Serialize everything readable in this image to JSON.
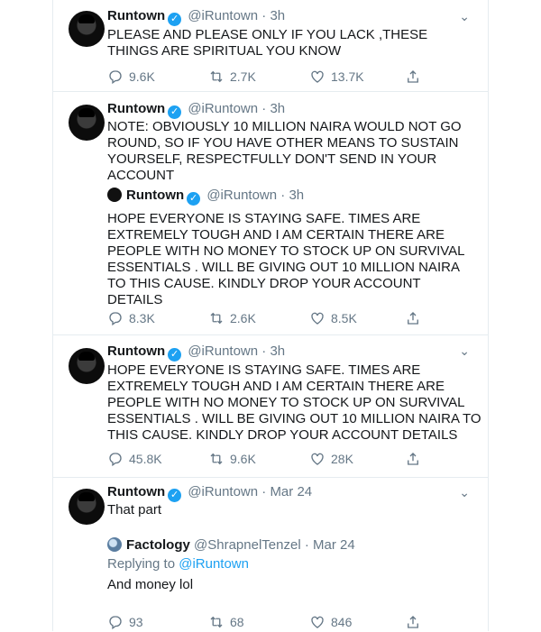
{
  "tweets": [
    {
      "name": "Runtown",
      "handle": "@iRuntown",
      "sep": "·",
      "time": "3h",
      "text": "PLEASE AND PLEASE ONLY IF YOU LACK ,THESE THINGS ARE SPIRITUAL YOU KNOW",
      "replies": "9.6K",
      "retweets": "2.7K",
      "likes": "13.7K"
    },
    {
      "name": "Runtown",
      "handle": "@iRuntown",
      "sep": "·",
      "time": "3h",
      "text": "NOTE: OBVIOUSLY 10 MILLION NAIRA WOULD NOT GO ROUND, SO IF YOU HAVE OTHER MEANS TO SUSTAIN YOURSELF, RESPECTFULLY DON'T SEND IN YOUR ACCOUNT",
      "quote": {
        "name": "Runtown",
        "handle": "@iRuntown",
        "sep": "·",
        "time": "3h",
        "text": "HOPE EVERYONE IS STAYING SAFE. TIMES ARE EXTREMELY TOUGH AND I AM CERTAIN THERE ARE PEOPLE WITH NO MONEY TO STOCK UP ON SURVIVAL ESSENTIALS . WILL BE GIVING OUT 10 MILLION NAIRA TO THIS CAUSE. KINDLY DROP YOUR ACCOUNT DETAILS"
      },
      "replies": "8.3K",
      "retweets": "2.6K",
      "likes": "8.5K"
    },
    {
      "name": "Runtown",
      "handle": "@iRuntown",
      "sep": "·",
      "time": "3h",
      "text": "HOPE EVERYONE IS STAYING SAFE. TIMES ARE EXTREMELY TOUGH AND I AM CERTAIN THERE ARE PEOPLE WITH NO MONEY TO STOCK UP ON SURVIVAL ESSENTIALS . WILL BE GIVING OUT 10 MILLION NAIRA TO THIS CAUSE. KINDLY DROP YOUR ACCOUNT DETAILS",
      "replies": "45.8K",
      "retweets": "9.6K",
      "likes": "28K"
    },
    {
      "name": "Runtown",
      "handle": "@iRuntown",
      "sep": "·",
      "time": "Mar 24",
      "text": "That part",
      "quote": {
        "name": "Factology",
        "handle": "@ShrapnelTenzel",
        "sep": "·",
        "time": "Mar 24",
        "replying_prefix": "Replying to",
        "replying_to": "@iRuntown",
        "text": "And money lol"
      },
      "replies": "93",
      "retweets": "68",
      "likes": "846"
    }
  ],
  "icons": {
    "verified": "✓",
    "caret": "chevron-down-icon",
    "reply": "reply-icon",
    "retweet": "retweet-icon",
    "like": "heart-icon",
    "share": "share-icon"
  },
  "colors": {
    "verified": "#1da1f2",
    "muted": "#657786",
    "link": "#1da1f2"
  }
}
